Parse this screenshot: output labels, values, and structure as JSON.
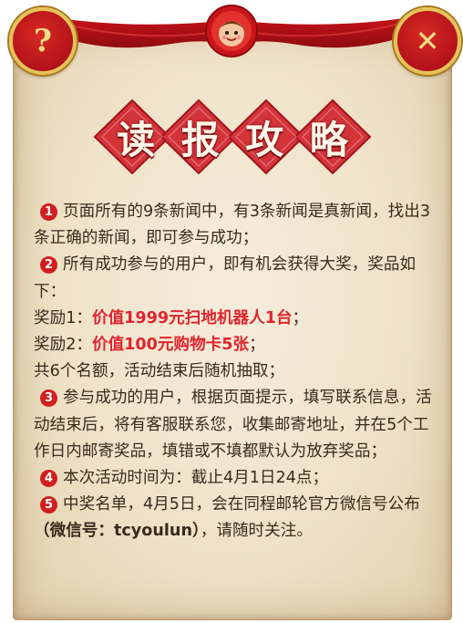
{
  "header": {
    "help_icon_glyph": "?",
    "close_icon_glyph": "✕"
  },
  "title": {
    "chars": [
      "读",
      "报",
      "攻",
      "略"
    ]
  },
  "rules": [
    {
      "num": "1",
      "text": "页面所有的9条新闻中，有3条新闻是真新闻，找出3条正确的新闻，即可参与成功；"
    },
    {
      "num": "2",
      "text": "所有成功参与的用户，即有机会获得大奖，奖品如下："
    },
    {
      "num": "3",
      "text": "参与成功的用户，根据页面提示，填写联系信息，活动结束后，将有客服联系您，收集邮寄地址，并在5个工作日内邮寄奖品，填错或不填都默认为放弃奖品；"
    },
    {
      "num": "4",
      "text": "本次活动时间为：截止4月1日24点；"
    },
    {
      "num": "5",
      "text": "中奖名单，4月5日，会在同程邮轮官方微信号公布"
    }
  ],
  "prizes": [
    {
      "label": "奖励1：",
      "value": "价值1999元扫地机器人1台",
      "suffix": "；"
    },
    {
      "label": "奖励2：",
      "value": "价值100元购物卡5张",
      "suffix": "；"
    }
  ],
  "quota_text": "共6个名额，活动结束后随机抽取；",
  "wechat": {
    "prefix": "（微信号：tcyoulun）",
    "suffix": "，请随时关注。"
  },
  "colors": {
    "accent_red": "#e0252e",
    "badge_red": "#d11f1f",
    "text_brown": "#3a2a1c",
    "gold": "#e6c25a"
  }
}
